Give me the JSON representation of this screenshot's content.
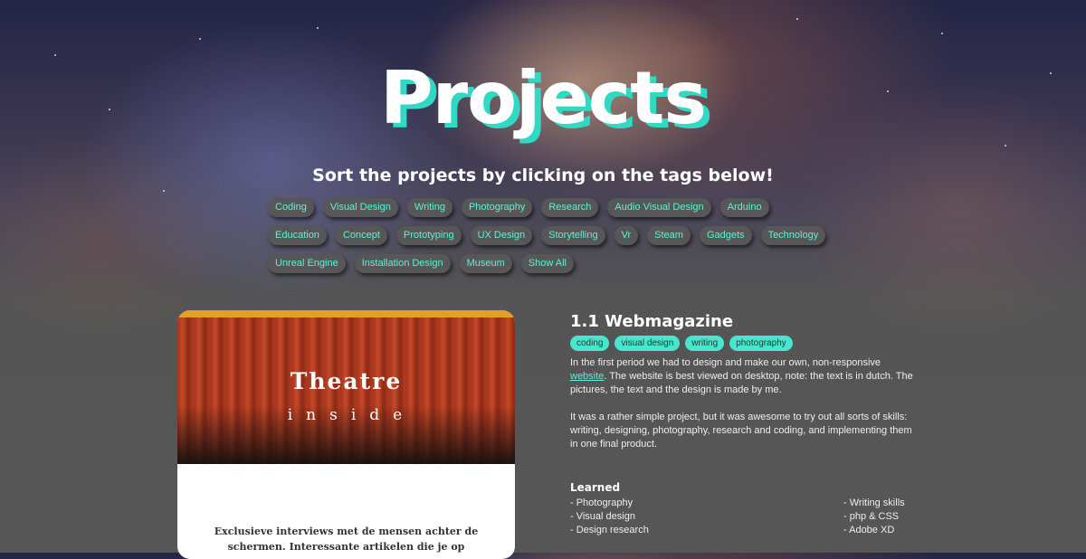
{
  "header": {
    "title": "Projects",
    "subtitle": "Sort the projects by clicking on the tags below!"
  },
  "tags": {
    "rows": [
      [
        "Coding",
        "Visual Design",
        "Writing",
        "Photography",
        "Research",
        "Audio Visual Design",
        "Arduino"
      ],
      [
        "Education",
        "Concept",
        "Prototyping",
        "UX Design",
        "Storytelling",
        "Vr",
        "Steam",
        "Gadgets",
        "Technology"
      ],
      [
        "Unreal Engine",
        "Installation Design",
        "Museum",
        "Show All"
      ]
    ]
  },
  "card": {
    "image_title": "Theatre",
    "image_subtitle": "inside",
    "text": "Exclusieve interviews met de mensen achter de schermen. Interessante artikelen die je op"
  },
  "project": {
    "title": "1.1 Webmagazine",
    "tags": [
      "coding",
      "visual design",
      "writing",
      "photography"
    ],
    "para1_before": "In the first period we had to design and make our own, non-responsive",
    "para1_link": "website",
    "para1_after": ". The website is best viewed on desktop, note: the text is in dutch. The pictures, the text and the design is made by me.",
    "para2": "It was a rather simple project, but it was awesome to try out all sorts of skills: writing, designing, photography, research and coding, and implementing them in one final product."
  },
  "learned": {
    "title": "Learned",
    "col1": [
      "- Photography",
      "- Visual design",
      "- Design research"
    ],
    "col2": [
      "- Writing skills",
      "- php & CSS",
      "- Adobe XD"
    ]
  },
  "colors": {
    "accent": "#2fd9c4",
    "tag_text": "#5ef0d8",
    "tag_bg": "#575757",
    "card_top": "#e2a120"
  }
}
